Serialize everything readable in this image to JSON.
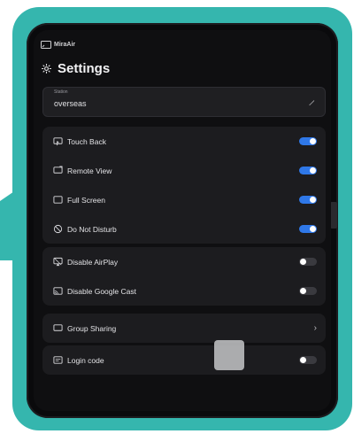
{
  "app": {
    "brand": "MiraAir"
  },
  "header": {
    "title": "Settings"
  },
  "station": {
    "label": "Station",
    "value": "overseas"
  },
  "groups": {
    "display": [
      {
        "label": "Touch Back",
        "state": "on",
        "icon": "touch-back-icon"
      },
      {
        "label": "Remote View",
        "state": "on",
        "icon": "remote-view-icon"
      },
      {
        "label": "Full Screen",
        "state": "on",
        "icon": "full-screen-icon"
      },
      {
        "label": "Do Not Disturb",
        "state": "on",
        "icon": "do-not-disturb-icon"
      }
    ],
    "cast": [
      {
        "label": "Disable AirPlay",
        "state": "off",
        "icon": "airplay-icon"
      },
      {
        "label": "Disable Google Cast",
        "state": "off",
        "icon": "google-cast-icon"
      }
    ],
    "sharing": {
      "label": "Group Sharing",
      "icon": "group-sharing-icon"
    },
    "login": {
      "label": "Login code",
      "state": "off",
      "icon": "login-code-icon"
    }
  },
  "colors": {
    "frame": "#35b6ae",
    "toggle_on": "#2f78e8",
    "toggle_off": "#3a3a3f",
    "card": "#1c1c1f",
    "screen": "#0f0f11"
  }
}
